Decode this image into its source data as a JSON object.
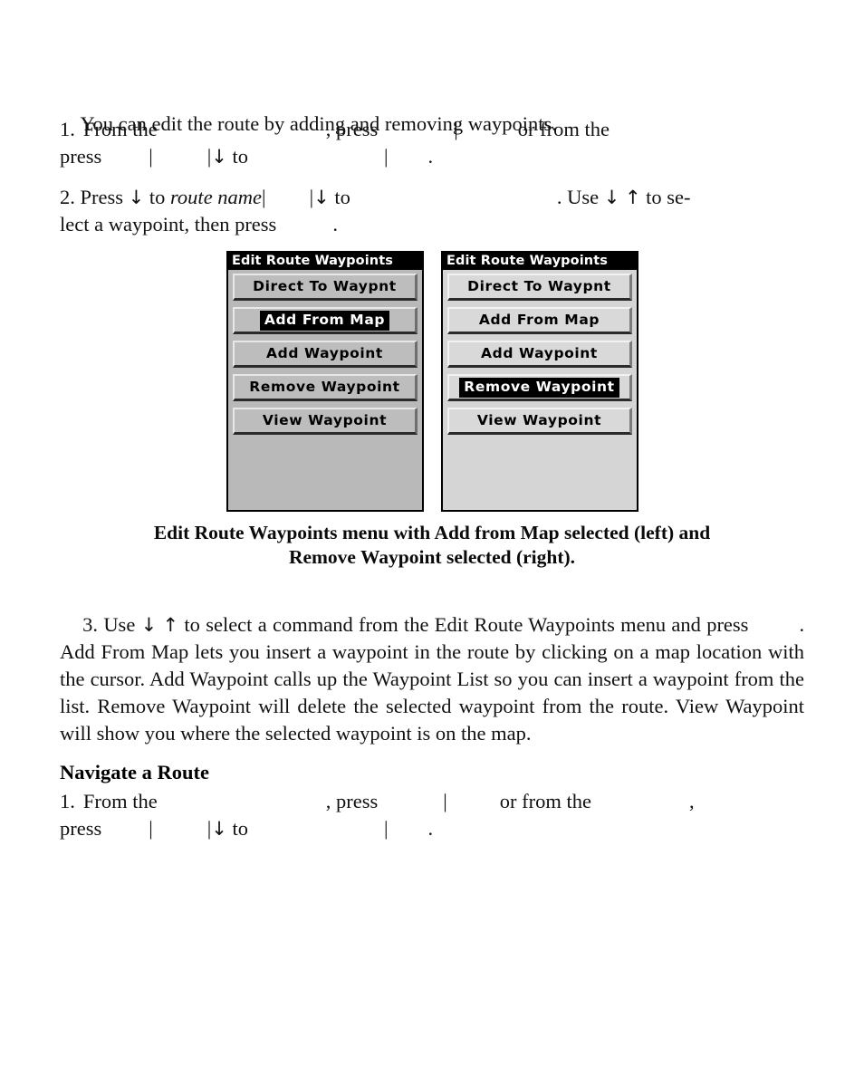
{
  "document": {
    "page_background": "#ffffff",
    "text_color": "#111111"
  },
  "intro": {
    "text": "You can edit the route by adding and removing waypoints."
  },
  "step1": {
    "number": "1.",
    "line1_a": "From  the",
    "line1_b": ",  press",
    "line1_pipe": "|",
    "line1_c": "or  from  the",
    "line2_a": "press",
    "line2_pipe1": "|",
    "line2_pipe2": "|",
    "line2_arrow": "↓",
    "line2_to": "to",
    "line2_pipe3": "|",
    "line2_period": "."
  },
  "step2": {
    "number": "2.",
    "line1_a": "Press",
    "line1_arrow1": "↓",
    "line1_to1": "to",
    "line1_italic": "route name",
    "line1_pipe1": "|",
    "line1_pipe2": "|",
    "line1_arrow2": "↓",
    "line1_to2": "to",
    "line1_period": ".",
    "line1_use": "Use",
    "line1_arrow3": "↓",
    "line1_arrow4": "↑",
    "line1_tail": "to se-",
    "line2": "lect a waypoint, then press",
    "line2_period": "."
  },
  "figures": {
    "left_menu": {
      "title": "Edit Route Waypoints",
      "background": "#b9b9b9",
      "items": [
        {
          "label": "Direct To Waypnt",
          "selected": false
        },
        {
          "label": "Add From Map",
          "selected": true
        },
        {
          "label": "Add Waypoint",
          "selected": false
        },
        {
          "label": "Remove Waypoint",
          "selected": false
        },
        {
          "label": "View Waypoint",
          "selected": false
        }
      ]
    },
    "right_menu": {
      "title": "Edit Route Waypoints",
      "background": "#d5d5d5",
      "items": [
        {
          "label": "Direct To Waypnt",
          "selected": false
        },
        {
          "label": "Add From Map",
          "selected": false
        },
        {
          "label": "Add Waypoint",
          "selected": false
        },
        {
          "label": "Remove Waypoint",
          "selected": true
        },
        {
          "label": "View Waypoint",
          "selected": false
        }
      ]
    },
    "caption_line1": "Edit Route Waypoints menu with Add from Map selected (left) and",
    "caption_line2": "Remove Waypoint selected (right)."
  },
  "step3": {
    "number": "3.",
    "part_a": "Use",
    "arrow_down": "↓",
    "arrow_up": "↑",
    "part_b": "to select a command from the Edit Route Waypoints menu and press",
    "part_c": ". Add From Map lets you insert a waypoint in the route by clicking on a map location with the cursor. Add Waypoint calls up the Waypoint List so you can insert a waypoint from the list. Remove Waypoint will delete the selected waypoint from the route. View Waypoint will show you where the selected waypoint is on the map."
  },
  "navigate": {
    "heading": "Navigate a Route",
    "step1": {
      "number": "1.",
      "line1_a": "From  the",
      "line1_b": ",  press",
      "line1_pipe": "|",
      "line1_c": "or  from  the",
      "line1_comma": ",",
      "line2_a": "press",
      "line2_pipe1": "|",
      "line2_pipe2": "|",
      "line2_arrow": "↓",
      "line2_to": "to",
      "line2_pipe3": "|",
      "line2_period": "."
    }
  }
}
